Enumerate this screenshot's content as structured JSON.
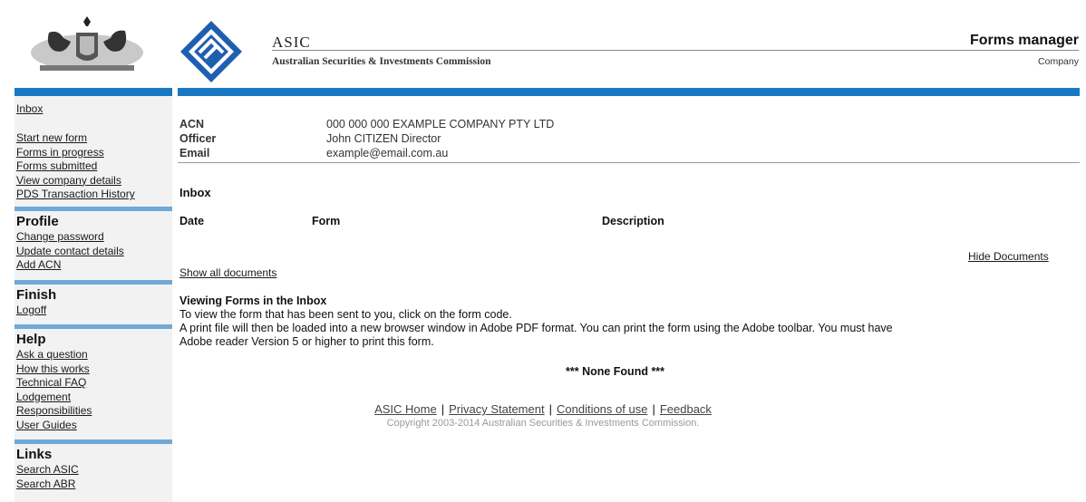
{
  "header": {
    "org_name": "ASIC",
    "org_full": "Australian Securities & Investments Commission",
    "app_title": "Forms manager",
    "app_subtitle": "Company"
  },
  "sidebar": {
    "top_links": [
      "Inbox"
    ],
    "form_links": [
      "Start new form",
      "Forms in progress",
      "Forms submitted",
      "View company details",
      "PDS Transaction History"
    ],
    "profile": {
      "title": "Profile",
      "links": [
        "Change password",
        "Update contact details",
        "Add ACN"
      ]
    },
    "finish": {
      "title": "Finish",
      "links": [
        "Logoff"
      ]
    },
    "help": {
      "title": "Help",
      "links": [
        "Ask a question",
        "How this works",
        "Technical FAQ",
        "Lodgement",
        "Responsibilities",
        "User Guides"
      ]
    },
    "links": {
      "title": "Links",
      "links": [
        "Search ASIC",
        "Search ABR"
      ]
    }
  },
  "company": {
    "acn_label": "ACN",
    "acn_value": "000 000 000 EXAMPLE COMPANY PTY LTD",
    "officer_label": "Officer",
    "officer_value": "John CITIZEN Director",
    "email_label": "Email",
    "email_value": "example@email.com.au"
  },
  "inbox": {
    "title": "Inbox",
    "columns": [
      "Date",
      "Form",
      "Description"
    ],
    "hide_documents": "Hide Documents",
    "show_all": "Show all documents",
    "viewing_title": "Viewing Forms in the Inbox",
    "viewing_line1": "To view the form that has been sent to you, click on the form code.",
    "viewing_line2": "A print file will then be loaded into a new browser window in Adobe PDF format. You can print the form using the Adobe toolbar. You must have",
    "viewing_line3": "Adobe reader Version 5 or higher to print this form.",
    "none_found": "*** None Found ***"
  },
  "footer": {
    "links": [
      "ASIC Home",
      "Privacy Statement",
      "Conditions of use",
      "Feedback"
    ],
    "copyright": "Copyright 2003-2014 Australian Securities & Investments Commission."
  },
  "colors": {
    "accent_bar": "#1a78c2",
    "separator": "#6fa9d8",
    "logo_blue": "#1f5fb0"
  }
}
